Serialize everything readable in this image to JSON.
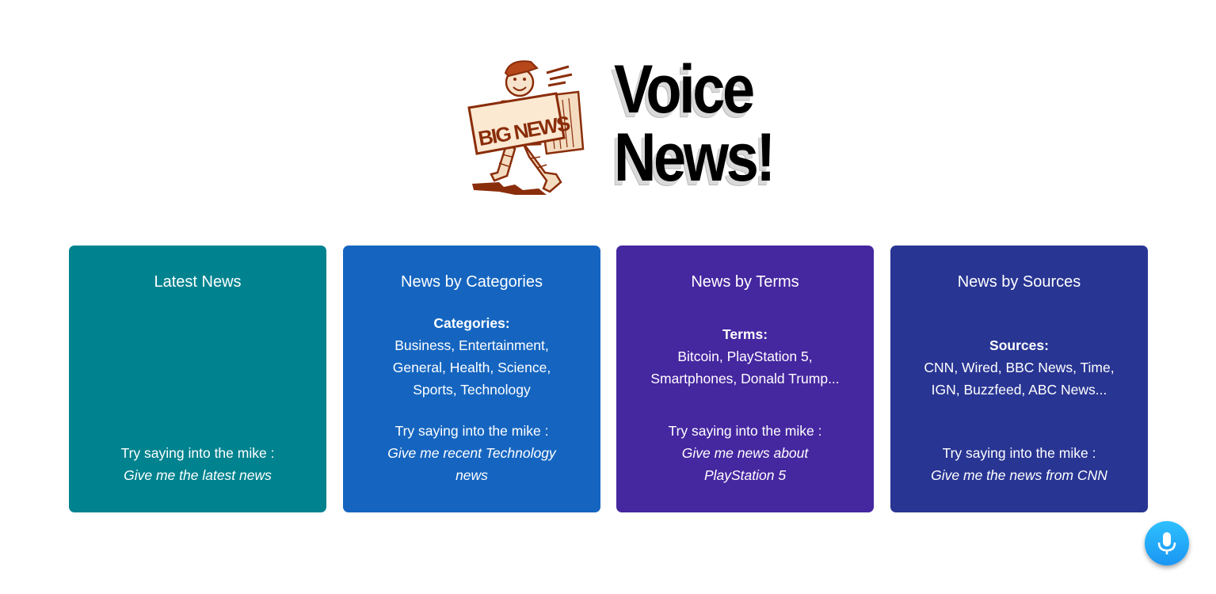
{
  "header": {
    "logo_sign_text": "BIG NEWS",
    "title_line1": "Voice",
    "title_line2": "News!"
  },
  "cards": [
    {
      "title": "Latest News",
      "color": "#00838f",
      "try_label": "Try saying into the mike :",
      "example": "Give me the latest news"
    },
    {
      "title": "News by Categories",
      "color": "#1565c0",
      "list_label": "Categories:",
      "list_text": "Business, Entertainment, General, Health, Science, Sports, Technology",
      "try_label": "Try saying into the mike :",
      "example": "Give me recent Technology news"
    },
    {
      "title": "News by Terms",
      "color": "#4527a0",
      "list_label": "Terms:",
      "list_text": "Bitcoin, PlayStation 5, Smartphones, Donald Trump...",
      "try_label": "Try saying into the mike :",
      "example": "Give me news about PlayStation 5"
    },
    {
      "title": "News by Sources",
      "color": "#283593",
      "list_label": "Sources:",
      "list_text": "CNN, Wired, BBC News, Time, IGN, Buzzfeed, ABC News...",
      "try_label": "Try saying into the mike :",
      "example": "Give me the news from CNN"
    }
  ],
  "mic_button": {
    "icon": "microphone-icon",
    "color": "#1fa8f7"
  }
}
